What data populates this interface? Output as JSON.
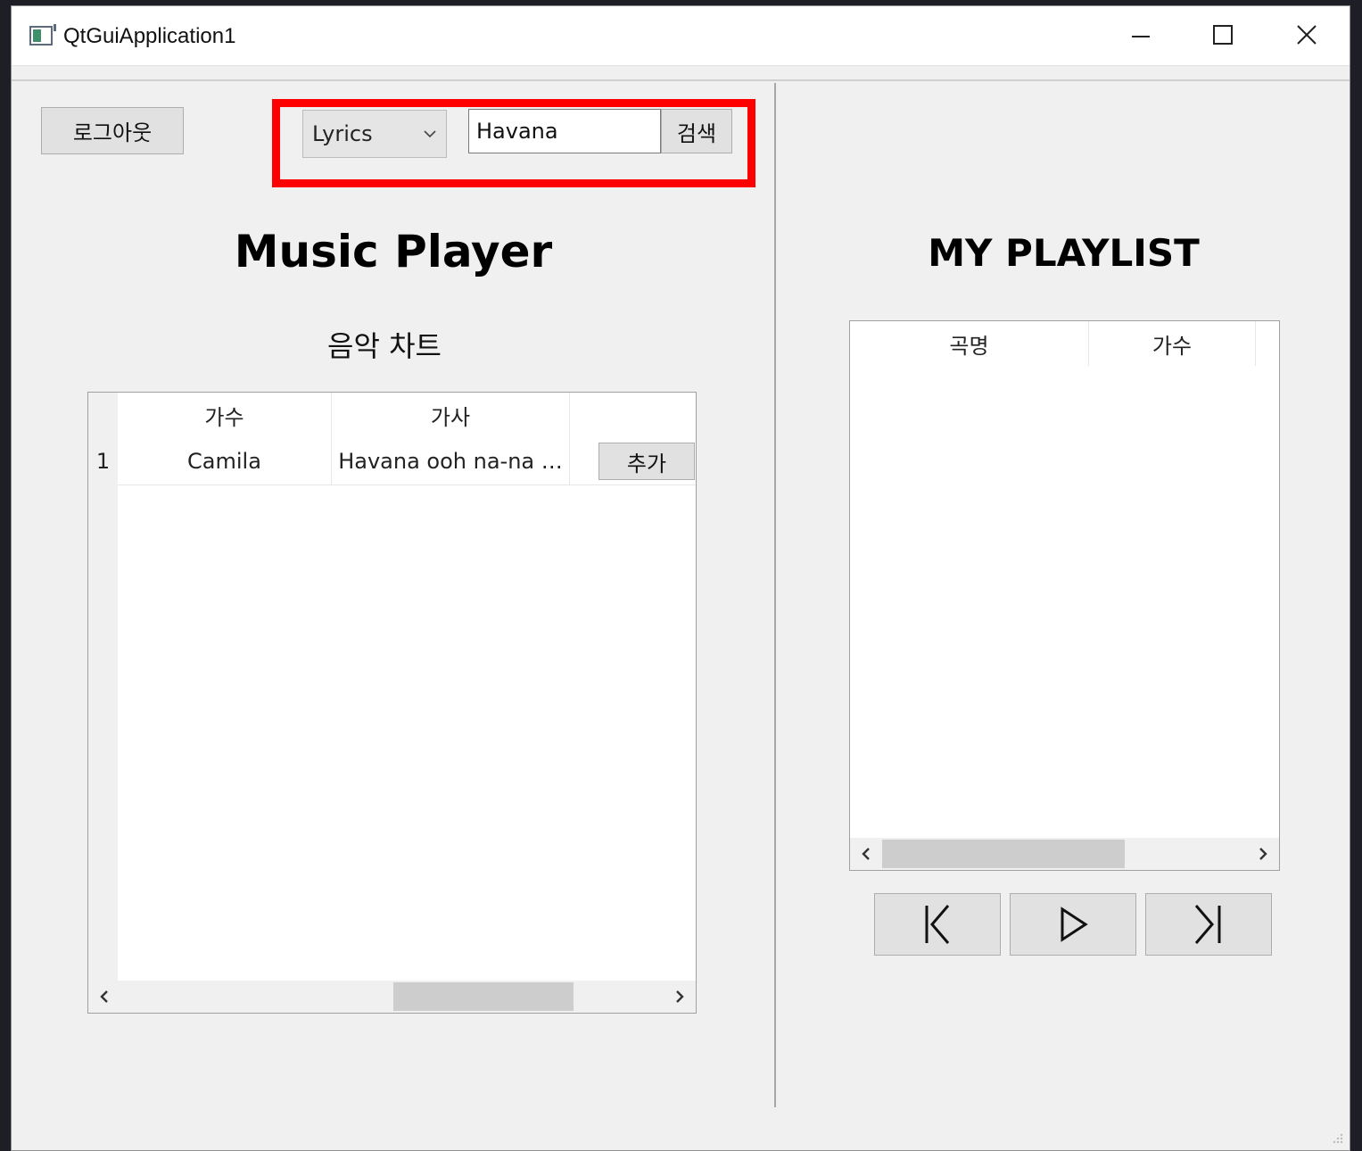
{
  "window": {
    "title": "QtGuiApplication1",
    "icons": [
      "app-icon",
      "minimize-icon",
      "maximize-icon",
      "close-icon"
    ]
  },
  "toolbar": {
    "logout_label": "로그아웃",
    "search_category": "Lyrics",
    "search_value": "Havana",
    "search_button_label": "검색",
    "highlight_color": "#ff0000"
  },
  "main": {
    "app_title": "Music Player",
    "chart_title": "음악 차트",
    "chart_table": {
      "columns": [
        "가수",
        "가사",
        ""
      ],
      "rows": [
        {
          "index": "1",
          "artist": "Camila",
          "lyrics": "Havana ooh na-na …",
          "action": "추가"
        }
      ]
    }
  },
  "playlist": {
    "title": "MY PLAYLIST",
    "columns": [
      "곡명",
      "가수"
    ]
  },
  "player": {
    "icons": [
      "previous-icon",
      "play-icon",
      "next-icon"
    ]
  }
}
